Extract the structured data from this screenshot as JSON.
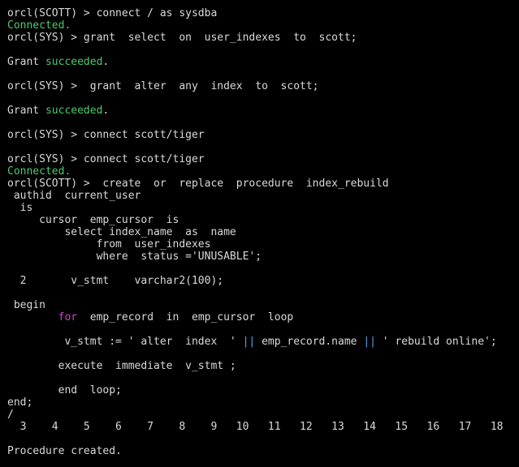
{
  "theme": {
    "background": "#000000",
    "text": "#d9d9d9",
    "success": "#4ec96b",
    "keyword": "#cc44cc",
    "operator": "#5aa2e6"
  },
  "terminal": {
    "lines": [
      {
        "row": 0,
        "segments": [
          {
            "text": "orcl(SCOTT) > connect / as sysdba",
            "color": "default"
          }
        ]
      },
      {
        "row": 1,
        "segments": [
          {
            "text": "Connected.",
            "color": "green"
          }
        ]
      },
      {
        "row": 2,
        "segments": [
          {
            "text": "orcl(SYS) > grant  select  on  user_indexes  to  scott;",
            "color": "default"
          }
        ]
      },
      {
        "row": 4,
        "segments": [
          {
            "text": "Grant ",
            "color": "default"
          },
          {
            "text": "succeeded",
            "color": "green"
          },
          {
            "text": ".",
            "color": "default"
          }
        ]
      },
      {
        "row": 6,
        "segments": [
          {
            "text": "orcl(SYS) >  grant  alter  any  index  to  scott;",
            "color": "default"
          }
        ]
      },
      {
        "row": 8,
        "segments": [
          {
            "text": "Grant ",
            "color": "default"
          },
          {
            "text": "succeeded",
            "color": "green"
          },
          {
            "text": ".",
            "color": "default"
          }
        ]
      },
      {
        "row": 10,
        "segments": [
          {
            "text": "orcl(SYS) > connect scott/tiger",
            "color": "default"
          }
        ]
      },
      {
        "row": 12,
        "segments": [
          {
            "text": "orcl(SYS) > connect scott/tiger",
            "color": "default"
          }
        ]
      },
      {
        "row": 13,
        "segments": [
          {
            "text": "Connected.",
            "color": "green"
          }
        ]
      },
      {
        "row": 14,
        "segments": [
          {
            "text": "orcl(SCOTT) >  create  or  replace  procedure  index_rebuild",
            "color": "default"
          }
        ]
      },
      {
        "row": 15,
        "segments": [
          {
            "text": " authid  current_user",
            "color": "default"
          }
        ]
      },
      {
        "row": 16,
        "segments": [
          {
            "text": "  is",
            "color": "default"
          }
        ]
      },
      {
        "row": 17,
        "segments": [
          {
            "text": "     cursor  emp_cursor  is",
            "color": "default"
          }
        ]
      },
      {
        "row": 18,
        "segments": [
          {
            "text": "         select index_name  as  name",
            "color": "default"
          }
        ]
      },
      {
        "row": 19,
        "segments": [
          {
            "text": "              from  user_indexes",
            "color": "default"
          }
        ]
      },
      {
        "row": 20,
        "segments": [
          {
            "text": "              where  status ='UNUSABLE';",
            "color": "default"
          }
        ]
      },
      {
        "row": 22,
        "segments": [
          {
            "text": "  2       v_stmt    varchar2(100);",
            "color": "default"
          }
        ]
      },
      {
        "row": 24,
        "segments": [
          {
            "text": " begin",
            "color": "default"
          }
        ]
      },
      {
        "row": 25,
        "segments": [
          {
            "text": "        ",
            "color": "default"
          },
          {
            "text": "for",
            "color": "purple"
          },
          {
            "text": "  emp_record  in  emp_cursor  loop",
            "color": "default"
          }
        ]
      },
      {
        "row": 27,
        "segments": [
          {
            "text": "         v_stmt := ' alter  index  ' ",
            "color": "default"
          },
          {
            "text": "||",
            "color": "blue"
          },
          {
            "text": " emp_record.name ",
            "color": "default"
          },
          {
            "text": "||",
            "color": "blue"
          },
          {
            "text": " ' rebuild online';",
            "color": "default"
          }
        ]
      },
      {
        "row": 29,
        "segments": [
          {
            "text": "        execute  immediate  v_stmt ;",
            "color": "default"
          }
        ]
      },
      {
        "row": 31,
        "segments": [
          {
            "text": "        end  loop;",
            "color": "default"
          }
        ]
      },
      {
        "row": 32,
        "segments": [
          {
            "text": "end;",
            "color": "default"
          }
        ]
      },
      {
        "row": 33,
        "segments": [
          {
            "text": "/",
            "color": "default"
          }
        ]
      },
      {
        "row": 34,
        "segments": [
          {
            "text": "  3    4    5    6    7    8    9   10   11   12   13   14   15   16   17   18",
            "color": "default"
          }
        ]
      },
      {
        "row": 36,
        "segments": [
          {
            "text": "Procedure created.",
            "color": "default"
          }
        ]
      }
    ]
  }
}
